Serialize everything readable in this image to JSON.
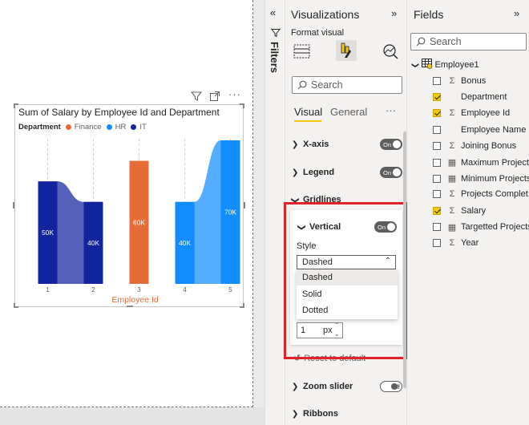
{
  "visual": {
    "title": "Sum of Salary by Employee Id and Department",
    "legend_title": "Department",
    "legend": [
      {
        "name": "Finance",
        "color": "#E66C37"
      },
      {
        "name": "HR",
        "color": "#118DFF"
      },
      {
        "name": "IT",
        "color": "#12239E"
      }
    ]
  },
  "chart_data": {
    "type": "bar",
    "title": "Sum of Salary by Employee Id and Department",
    "xlabel": "Employee Id",
    "ylabel": "",
    "categories": [
      "1",
      "2",
      "3",
      "4",
      "5"
    ],
    "series": [
      {
        "name": "IT",
        "color": "#12239E",
        "values": [
          50000,
          40000,
          null,
          null,
          null
        ]
      },
      {
        "name": "Finance",
        "color": "#E66C37",
        "values": [
          null,
          null,
          60000,
          null,
          null
        ]
      },
      {
        "name": "HR",
        "color": "#118DFF",
        "values": [
          null,
          null,
          null,
          40000,
          70000
        ]
      }
    ],
    "data_labels": [
      "50K",
      "40K",
      "60K",
      "40K",
      "70K"
    ],
    "ribbons": true,
    "gridlines": {
      "vertical": true,
      "style": "Dashed"
    },
    "legend_position": "top-left",
    "ylim": [
      0,
      70000
    ]
  },
  "filters": {
    "label": "Filters"
  },
  "viz": {
    "title": "Visualizations",
    "format_label": "Format visual",
    "search_placeholder": "Search",
    "tabs": [
      "Visual",
      "General"
    ],
    "more": "···",
    "sections": [
      {
        "label": "X-axis",
        "toggle": "On"
      },
      {
        "label": "Legend",
        "toggle": "On"
      },
      {
        "label": "Gridlines"
      },
      {
        "label": "Zoom slider",
        "toggle": "Off"
      },
      {
        "label": "Ribbons"
      }
    ],
    "vertical": {
      "label": "Vertical",
      "toggle": "On",
      "style_label": "Style",
      "style_value": "Dashed",
      "options": [
        "Dashed",
        "Solid",
        "Dotted"
      ],
      "width_value": "1",
      "width_unit": "px",
      "reset": "Reset to default"
    }
  },
  "fields": {
    "title": "Fields",
    "search_placeholder": "Search",
    "table": "Employee1",
    "items": [
      {
        "name": "Bonus",
        "checked": false,
        "icon": "sigma"
      },
      {
        "name": "Department",
        "checked": true,
        "icon": "none"
      },
      {
        "name": "Employee Id",
        "checked": true,
        "icon": "sigma"
      },
      {
        "name": "Employee Name",
        "checked": false,
        "icon": "none"
      },
      {
        "name": "Joining Bonus",
        "checked": false,
        "icon": "sigma"
      },
      {
        "name": "Maximum Projects",
        "checked": false,
        "icon": "calculator"
      },
      {
        "name": "Minimum Projects",
        "checked": false,
        "icon": "calculator"
      },
      {
        "name": "Projects Complet...",
        "checked": false,
        "icon": "sigma"
      },
      {
        "name": "Salary",
        "checked": true,
        "icon": "sigma"
      },
      {
        "name": "Targetted Projects",
        "checked": false,
        "icon": "calculator"
      },
      {
        "name": "Year",
        "checked": false,
        "icon": "sigma"
      }
    ]
  }
}
